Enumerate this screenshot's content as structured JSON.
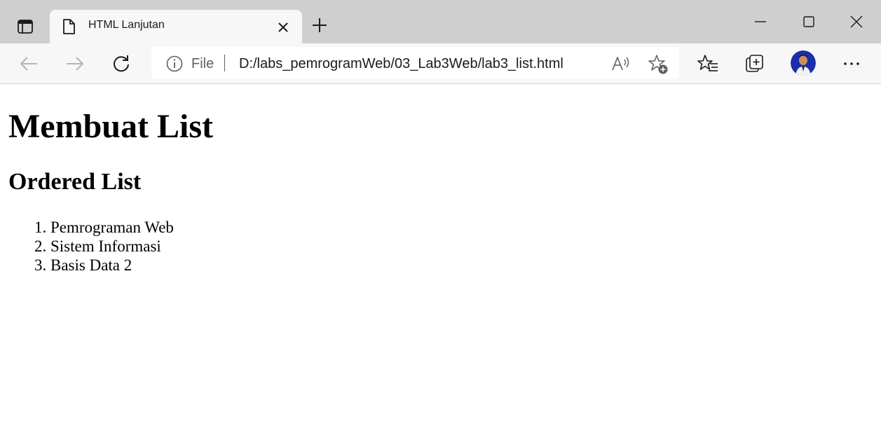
{
  "tab": {
    "title": "HTML Lanjutan"
  },
  "addressbar": {
    "scheme": "File",
    "url": "D:/labs_pemrogramWeb/03_Lab3Web/lab3_list.html"
  },
  "page": {
    "heading1": "Membuat List",
    "heading2": "Ordered List",
    "list": [
      {
        "text": "Pemrograman Web"
      },
      {
        "text": "Sistem Informasi"
      },
      {
        "text": "Basis Data 2"
      }
    ]
  },
  "colors": {
    "titlebar_bg": "#cfcfcf",
    "toolbar_bg": "#f7f7f7",
    "icon": "#1b1b1b",
    "disabled_icon": "#b5b5b5"
  },
  "icons": [
    "sidebar-icon",
    "file-icon",
    "close-icon",
    "plus-icon",
    "minimize-icon",
    "maximize-icon",
    "close-window-icon",
    "back-arrow-icon",
    "forward-arrow-icon",
    "reload-icon",
    "info-icon",
    "read-aloud-icon",
    "add-favorite-icon",
    "favorites-icon",
    "collections-icon",
    "avatar",
    "more-icon"
  ]
}
